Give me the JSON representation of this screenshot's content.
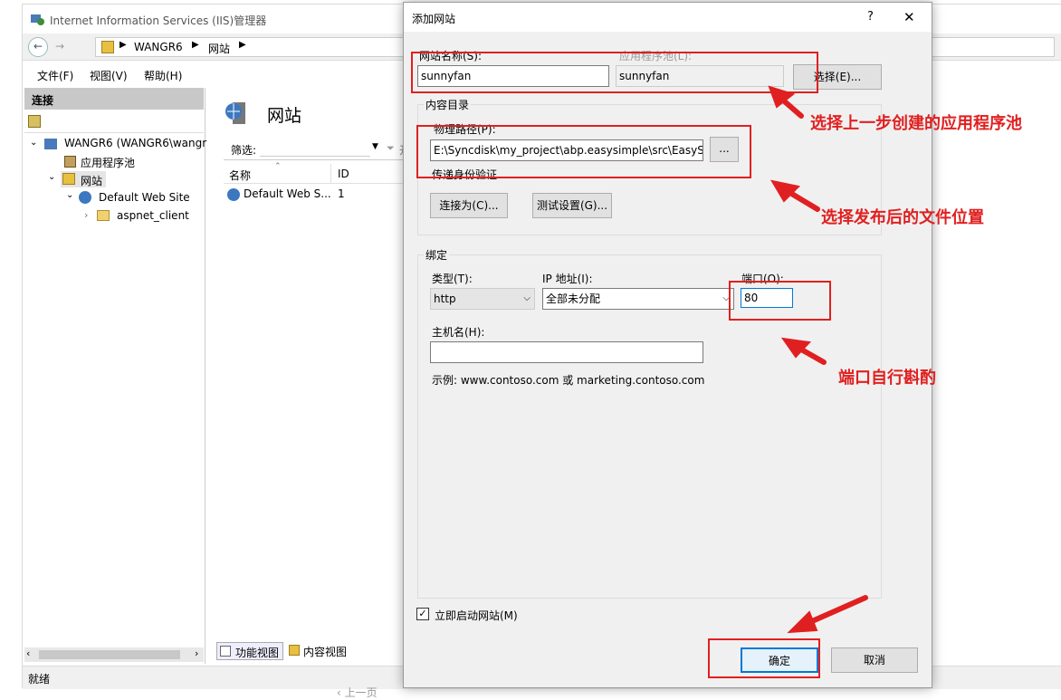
{
  "iis": {
    "title": "Internet Information Services (IIS)管理器",
    "breadcrumb": [
      "WANGR6",
      "网站"
    ],
    "menu": [
      "文件(F)",
      "视图(V)",
      "帮助(H)"
    ],
    "connections_title": "连接",
    "tree": {
      "server": "WANGR6 (WANGR6\\wangr",
      "app_pools": "应用程序池",
      "sites": "网站",
      "default_site": "Default Web Site",
      "aspnet_client": "aspnet_client"
    },
    "content": {
      "heading": "网站",
      "filter_label": "筛选:",
      "start_label": "开始",
      "columns": [
        "名称",
        "ID"
      ],
      "rows": [
        {
          "name": "Default Web S...",
          "id": "1"
        }
      ]
    },
    "view_tabs": [
      "功能视图",
      "内容视图"
    ],
    "status": "就绪",
    "prev_page": "‹ 上一页"
  },
  "dialog": {
    "title": "添加网站",
    "help": "?",
    "close": "✕",
    "site_name_label": "网站名称(S):",
    "site_name_value": "sunnyfan",
    "app_pool_label": "应用程序池(L):",
    "app_pool_value": "sunnyfan",
    "select_button": "选择(E)...",
    "content_dir_label": "内容目录",
    "physical_path_label": "物理路径(P):",
    "physical_path_value": "E:\\Syncdisk\\my_project\\abp.easysimple\\src\\EasySin",
    "browse_button": "...",
    "passthrough_label": "传递身份验证",
    "connect_as_button": "连接为(C)...",
    "test_settings_button": "测试设置(G)...",
    "binding_label": "绑定",
    "type_label": "类型(T):",
    "type_value": "http",
    "ip_label": "IP 地址(I):",
    "ip_value": "全部未分配",
    "port_label": "端口(O):",
    "port_value": "80",
    "hostname_label": "主机名(H):",
    "hostname_value": "",
    "example_text": "示例: www.contoso.com 或 marketing.contoso.com",
    "start_immediately_label": "立即启动网站(M)",
    "start_immediately_checked": true,
    "ok_button": "确定",
    "cancel_button": "取消"
  },
  "annotations": {
    "app_pool_note": "选择上一步创建的应用程序池",
    "path_note": "选择发布后的文件位置",
    "port_note": "端口自行斟酌",
    "color": "#e02020"
  }
}
